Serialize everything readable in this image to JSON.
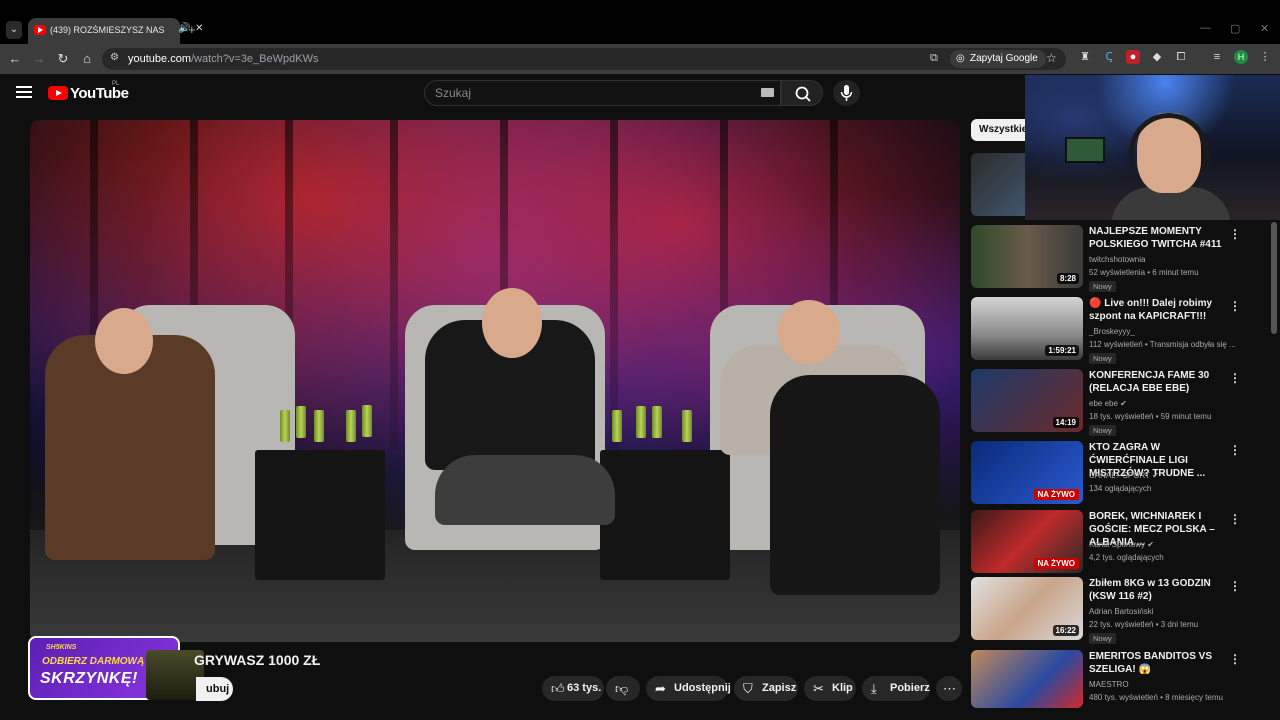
{
  "browser": {
    "tab_title": "(439) ROZŚMIESZYSZ NAS",
    "url_host": "youtube.com",
    "url_path": "/watch?v=3e_BeWpdKWs",
    "ask_google": "Zapytaj Google",
    "profile_initial": "H"
  },
  "youtube": {
    "country_code": "PL",
    "logo_text": "YouTube",
    "search_placeholder": "Szukaj"
  },
  "video": {
    "title_visible": "GRYWASZ 1000 ZŁ",
    "subscribe_label": "ubuj",
    "promo": {
      "brand": "SH5KINS",
      "line1": "ODBIERZ DARMOWĄ",
      "line2": "SKRZYNKĘ!"
    },
    "actions": {
      "likes": "63 tys.",
      "share": "Udostępnij",
      "save": "Zapisz",
      "clip": "Klip",
      "download": "Pobierz"
    }
  },
  "sidebar": {
    "chip_all": "Wszystkie",
    "recommendations": [
      {
        "title": "NAJLEPSZE MOMENTY POLSKIEGO TWITCHA #411",
        "channel": "twitchshotownia",
        "meta": "52 wyświetlenia • 6 minut temu",
        "badge": "Nowy",
        "duration": "8:28",
        "live": ""
      },
      {
        "title": "🔴 Live on!!! Dalej robimy szpont na KAPICRAFT!!!",
        "channel": "_Broskeyyy_",
        "meta": "112 wyświetleń • Transmisja odbyła się ...",
        "badge": "Nowy",
        "duration": "1:59:21",
        "live": ""
      },
      {
        "title": "KONFERENCJA FAME 30 (RELACJA EBE EBE)",
        "channel": "ebe ebe ✔",
        "meta": "18 tys. wyświetleń • 59 minut temu",
        "badge": "Nowy",
        "duration": "14:19",
        "live": ""
      },
      {
        "title": "KTO ZAGRA W ĆWIERĆFINALE LIGI MISTRZÓW? TRUDNE ...",
        "channel": "CANAL+ SPORT ✔",
        "meta": "134 oglądających",
        "badge": "",
        "duration": "",
        "live": "NA ŻYWO"
      },
      {
        "title": "BOREK, WICHNIAREK I GOŚCIE: MECZ POLSKA – ALBANIA ...",
        "channel": "Kanał Sportowy ✔",
        "meta": "4,2 tys. oglądających",
        "badge": "",
        "duration": "",
        "live": "NA ŻYWO"
      },
      {
        "title": "Zbiłem 8KG w 13 GODZIN (KSW 116 #2)",
        "channel": "Adrian Bartosiński",
        "meta": "22 tys. wyświetleń • 3 dni temu",
        "badge": "Nowy",
        "duration": "16:22",
        "live": ""
      },
      {
        "title": "EMERITOS BANDITOS VS SZELIGA! 😱",
        "channel": "MAESTRO",
        "meta": "480 tys. wyświetleń • 8 miesięcy temu",
        "badge": "",
        "duration": "",
        "live": ""
      }
    ]
  },
  "colors": {
    "bg": "#0f0f0f",
    "yt_red": "#ff0000",
    "live_red": "#cc0000",
    "chip_bg": "#272727"
  }
}
